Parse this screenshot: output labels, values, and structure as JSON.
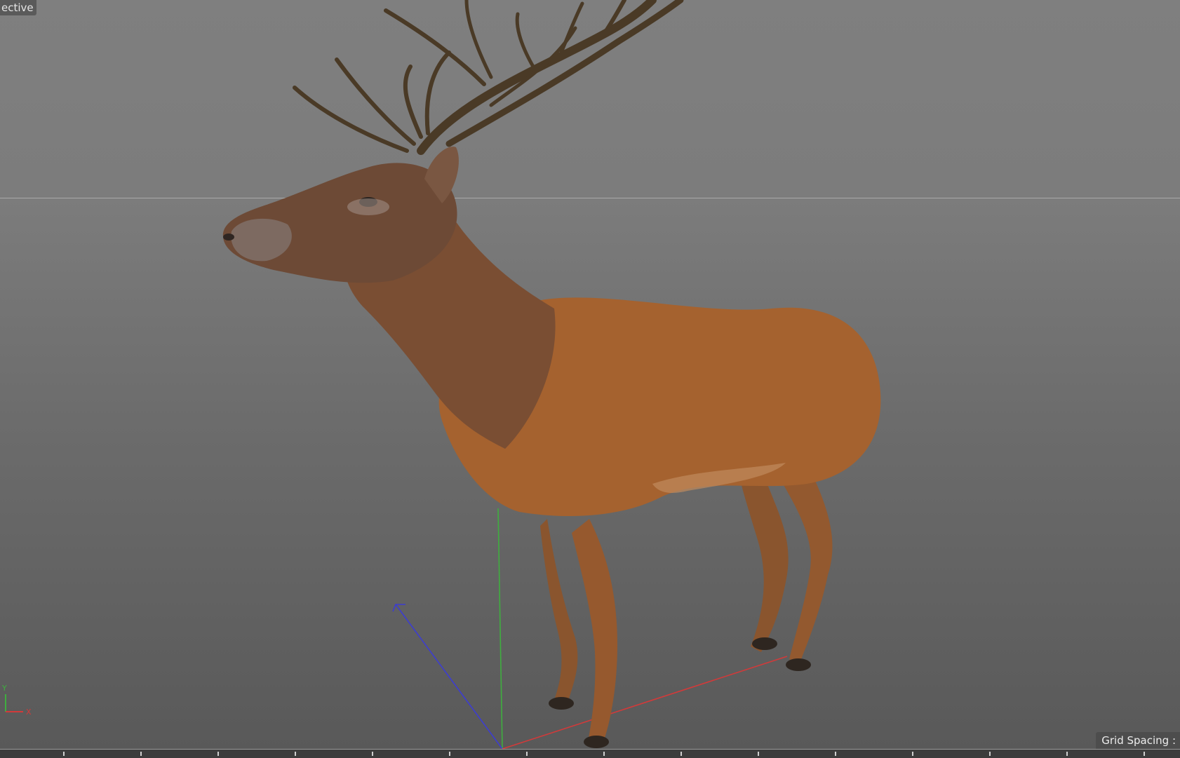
{
  "viewport": {
    "label": "ective",
    "grid_spacing_label": "Grid Spacing :",
    "axis_labels": {
      "y": "Y",
      "x": "X"
    }
  },
  "colors": {
    "x_axis": "#d23a3a",
    "y_axis": "#3fae3f",
    "z_axis": "#3d3dd0",
    "hide": "#8a5a30"
  },
  "icons": {
    "axis_gizmo": "xyz-axis-icon"
  }
}
